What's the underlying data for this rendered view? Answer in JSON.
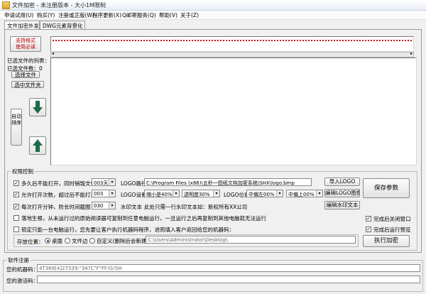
{
  "window": {
    "title": "文件加密 - 未注册版本 - 大小1M限制"
  },
  "menu": [
    "申请试用(U)",
    "购买(Y)",
    "注册或正版(W)",
    "程序更新(X)",
    "Q邮寄服务(Q)",
    "帮助(V)",
    "关于(Z)"
  ],
  "tabs": [
    "文件加密外发",
    "DWG元素背景化"
  ],
  "top": {
    "encrypt_format_button": "支持格式\n使用必读",
    "path_field": ""
  },
  "files": {
    "selected_list_label": "已选文件的列表：",
    "selected_count_label": "已选文件数：0",
    "select_file_button": "选择文件",
    "select_folder_button": "选中文件夹",
    "auto_sort_button": "自动排序"
  },
  "permissions": {
    "group_title": "权限控制",
    "row1": {
      "label": "多久后不能打开，同时销毁文件",
      "value": "003天",
      "logo_path_label": "LOGO路径",
      "logo_path": "C:\\Program Files (x86)\\五秒一图纸文档加密系统\\SHX\\logo.bmp",
      "import_logo": "导入LOGO"
    },
    "row2": {
      "label": "允许打开次数，超过后不能打开",
      "value": "003",
      "logo_setting_label": "LOGO设置",
      "shrink": "缩小是40%",
      "transparency": "透明度30%",
      "logo_pos_label": "LOGO位置",
      "pos_h": "中偏左00%",
      "pos_v": "中偏上00%",
      "edit_logo": "编辑LOGO图像"
    },
    "row3": {
      "label": "每次打开分钟，防长时间截图",
      "value": "030",
      "watermark_label": "水印文本",
      "watermark_text": "此处只需一行水印文本如：新权所有XX公司",
      "edit_watermark": "编辑水印文本"
    },
    "row4": {
      "label": "落地生根，从未运行过的原始阅读器可复制到任意电脑运行，一旦运行之后再复制到其他电脑就无法运行"
    },
    "row5": {
      "label": "锁定只能一台电脑运行，您先要让客户执行机器码程序，进而填入客户返回给您的机器码："
    },
    "save_params": "保存参数",
    "close_after_done": "完成后关闭窗口",
    "run_after_done": "完成后运行预览",
    "execute": "执行加密",
    "store_location_label": "存放位置：",
    "store_desktop": "桌面",
    "store_beside": "文件边",
    "store_custom": "自定义(删除后会新建)",
    "store_path": "C:\\Users\\Administrator\\Desktop\\"
  },
  "registration": {
    "section_title": "软件注册",
    "machine_code_label": "您的机器码：",
    "machine_code": "4T369[4]27339:\"34?C\"F\"FF!G!5H",
    "activation_label": "您的激活码："
  },
  "colors": {
    "accent_red": "#c00000",
    "arrow_green": "#1f6b4a"
  }
}
